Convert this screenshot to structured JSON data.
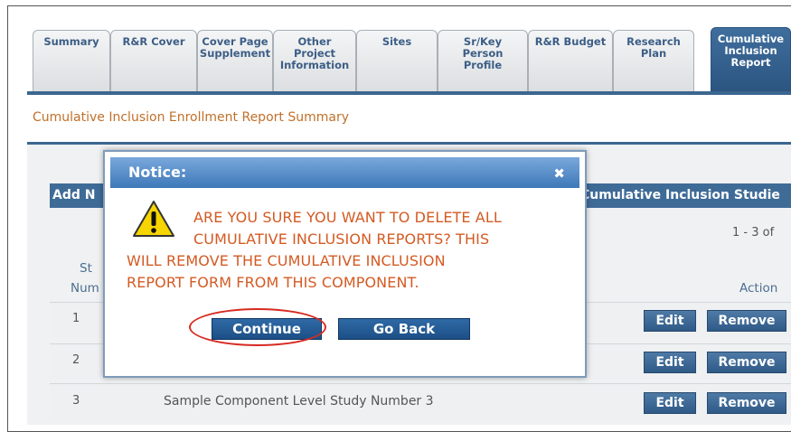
{
  "tabs": [
    {
      "label": "Summary"
    },
    {
      "label": "R&R Cover"
    },
    {
      "label": "Cover Page\nSupplement"
    },
    {
      "label": "Other\nProject\nInformation"
    },
    {
      "label": "Sites"
    },
    {
      "label": "Sr/Key\nPerson\nProfile"
    },
    {
      "label": "R&R Budget"
    },
    {
      "label": "Research\nPlan"
    },
    {
      "label": "Cumulative\nInclusion\nReport"
    }
  ],
  "section": {
    "title": "Cumulative Inclusion Enrollment Report Summary"
  },
  "table": {
    "add_label": "Add N",
    "studies_label": "Cumulative Inclusion Studie",
    "pager": "1 - 3 of",
    "col_study": "St",
    "col_num": "Num",
    "col_action": "Action",
    "rows": [
      {
        "num": "1",
        "text": ""
      },
      {
        "num": "2",
        "text": ""
      },
      {
        "num": "3",
        "text": "Sample Component Level Study Number 3"
      }
    ],
    "edit_label": "Edit",
    "remove_label": "Remove"
  },
  "modal": {
    "title": "Notice:",
    "close": "✖",
    "lines": [
      "ARE YOU SURE YOU WANT TO DELETE ALL",
      "CUMULATIVE INCLUSION REPORTS? THIS",
      "WILL REMOVE THE CUMULATIVE INCLUSION",
      "REPORT FORM FROM THIS COMPONENT."
    ],
    "continue_label": "Continue",
    "goback_label": "Go Back"
  },
  "colors": {
    "accent": "#3c6690",
    "warning_text": "#d45a23",
    "highlight": "#d72b22"
  }
}
